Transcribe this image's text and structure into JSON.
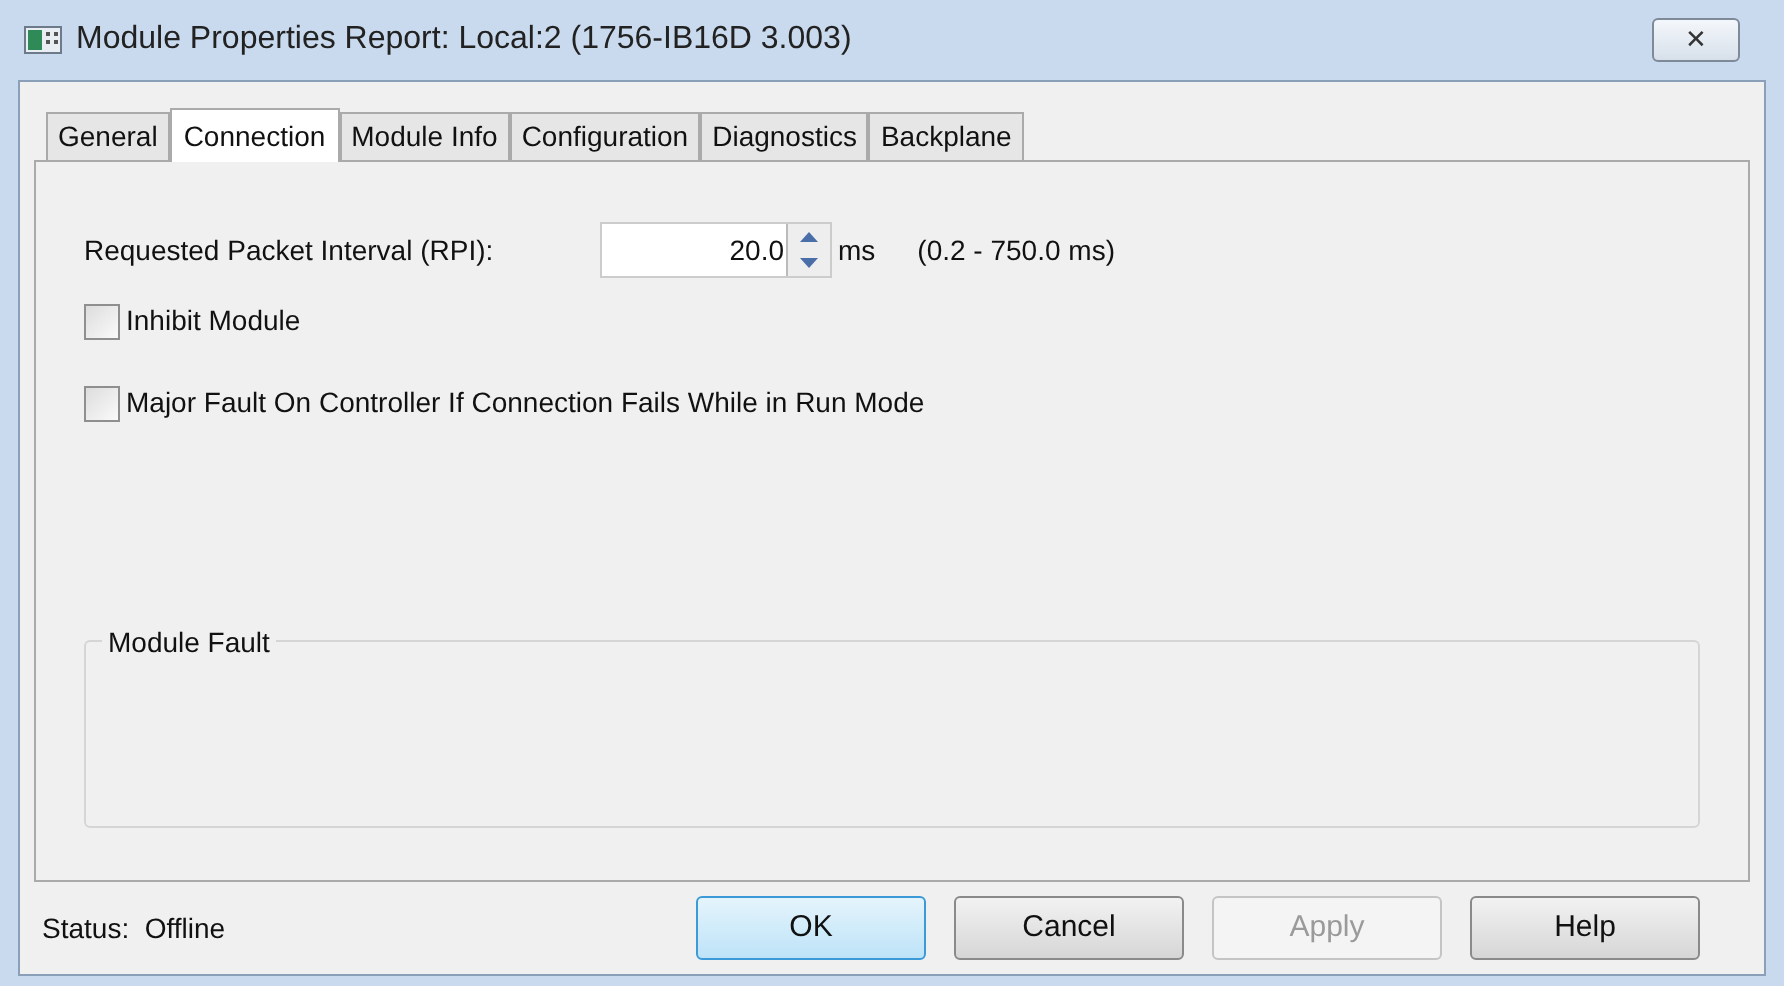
{
  "window": {
    "title": "Module Properties Report: Local:2 (1756-IB16D 3.003)",
    "close": "✕"
  },
  "tabs": [
    {
      "label": "General",
      "selected": false
    },
    {
      "label": "Connection",
      "selected": true
    },
    {
      "label": "Module Info",
      "selected": false
    },
    {
      "label": "Configuration",
      "selected": false
    },
    {
      "label": "Diagnostics",
      "selected": false
    },
    {
      "label": "Backplane",
      "selected": false
    }
  ],
  "rpi": {
    "label": "Requested Packet Interval (RPI):",
    "value": "20.0",
    "unit": "ms",
    "range": "(0.2 - 750.0 ms)"
  },
  "checkboxes": [
    {
      "label": "Inhibit Module",
      "checked": false
    },
    {
      "label": "Major Fault On Controller If Connection Fails While in Run Mode",
      "checked": false
    }
  ],
  "module_fault": {
    "title": "Module Fault"
  },
  "status": "Status:  Offline",
  "buttons": [
    {
      "label": "OK",
      "default": true,
      "disabled": false
    },
    {
      "label": "Cancel",
      "default": false,
      "disabled": false
    },
    {
      "label": "Apply",
      "default": false,
      "disabled": true
    },
    {
      "label": "Help",
      "default": false,
      "disabled": false
    }
  ]
}
